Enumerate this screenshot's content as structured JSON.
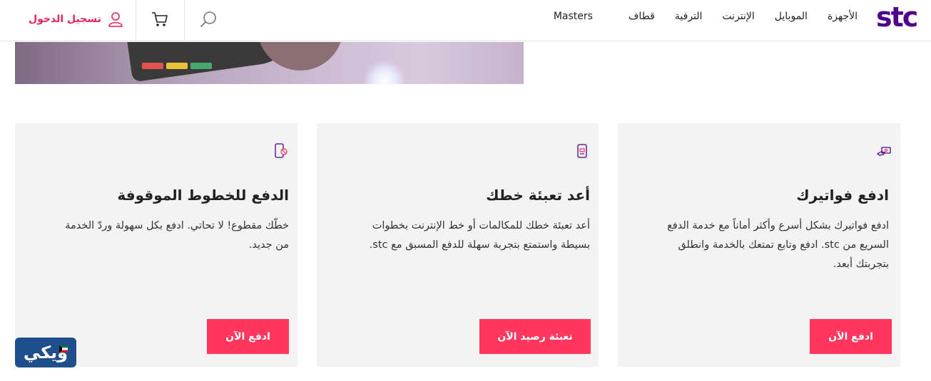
{
  "header": {
    "logo": "stc",
    "nav": [
      "الأجهزة",
      "الموبايل",
      "الإنترنت",
      "الترفية",
      "قطاف",
      "Masters"
    ],
    "login_label": "تسجيل الدخول"
  },
  "cards": [
    {
      "title": "ادفع فواتيرك",
      "lines": [
        "ادفع فواتيرك بشكل أسرع وأكثر أماناً مع خدمة الدفع",
        "السريع من stc. ادفع وتابع تمتعك بالخدمة وانطلق",
        "بتجربتك أبعد."
      ],
      "button": "ادفع الآن",
      "icon": "hand-money-icon"
    },
    {
      "title": "أعد تعبئة خطك",
      "lines": [
        "أعد تعبئة خطك للمكالمات أو خط الإنترنت بخطوات",
        "بسيطة واستمتع بتجربة سهلة للدفع المسبق مع stc."
      ],
      "button": "تعبئة رصيد الآن",
      "icon": "recharge-icon"
    },
    {
      "title": "الدفع للخطوط الموقوفة",
      "lines": [
        "خطّك مقطوع! لا تحاتي. ادفع بكل سهولة وردّ الخدمة",
        "من جديد."
      ],
      "button": "ادفع الآن",
      "icon": "phone-blocked-icon"
    }
  ],
  "watermark": "ويكي",
  "colors": {
    "brand": "#4f008c",
    "accent": "#ff375e",
    "card_bg": "#f3f3f3"
  }
}
